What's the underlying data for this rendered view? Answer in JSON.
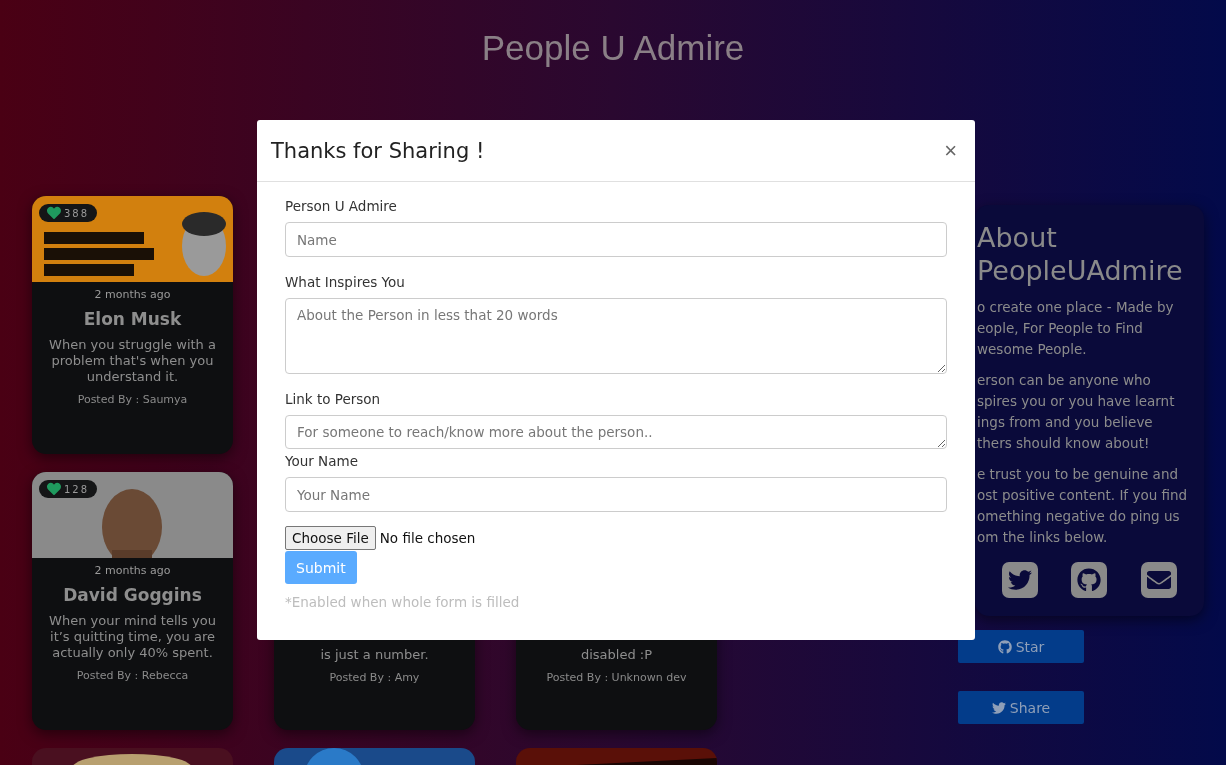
{
  "header": {
    "title": "People U Admire"
  },
  "card_rows": [
    [
      {
        "likes": "388",
        "time": "2 months ago",
        "name": "Elon Musk",
        "quote": "When you struggle with a problem that's when you understand it.",
        "posted_by": "Posted By : Saumya"
      }
    ],
    [
      {
        "likes": "128",
        "time": "2 months ago",
        "name": "David Goggins",
        "quote": "When your mind tells you it’s quitting time, you are actually only 40% spent.",
        "posted_by": "Posted By : Rebecca"
      },
      {
        "quote": "is just a number.",
        "posted_by": "Posted By : Amy"
      },
      {
        "quote": "disabled :P",
        "posted_by": "Posted By : Unknown dev"
      }
    ],
    [
      {
        "kind": "picture"
      },
      {
        "kind": "picture"
      },
      {
        "kind": "picture"
      }
    ]
  ],
  "about": {
    "title_lines": [
      "About",
      "PeopleUAdmire"
    ],
    "paragraphs": [
      [
        "o create one place - Made by",
        "eople, For People to Find",
        "wesome People."
      ],
      [
        "erson can be anyone who",
        "spires you or you have learnt",
        "ings from and you believe",
        "thers should know about!"
      ],
      [
        "e trust you to be genuine and",
        "ost positive content. If you find",
        "omething negative do ping us",
        "om the links below."
      ]
    ]
  },
  "actions": [
    {
      "label": "Star",
      "kind": "github"
    },
    {
      "label": "Share",
      "kind": "twitter"
    }
  ],
  "modal": {
    "title": "Thanks for Sharing !",
    "close": "×",
    "fields": [
      {
        "label": "Person U Admire",
        "placeholder": "Name",
        "kind": "input"
      },
      {
        "label": "What Inspires You",
        "placeholder": "About the Person in less that 20 words",
        "kind": "textarea"
      },
      {
        "label": "Link to Person",
        "placeholder": "For someone to reach/know more about the person..",
        "kind": "textline"
      },
      {
        "label": "Your Name",
        "placeholder": "Your Name",
        "kind": "input"
      }
    ],
    "file": {
      "button": "Choose File",
      "status": "No file chosen"
    },
    "submit": {
      "label": "Submit",
      "disabled": true
    },
    "hint": "*Enabled when whole form is filled"
  }
}
